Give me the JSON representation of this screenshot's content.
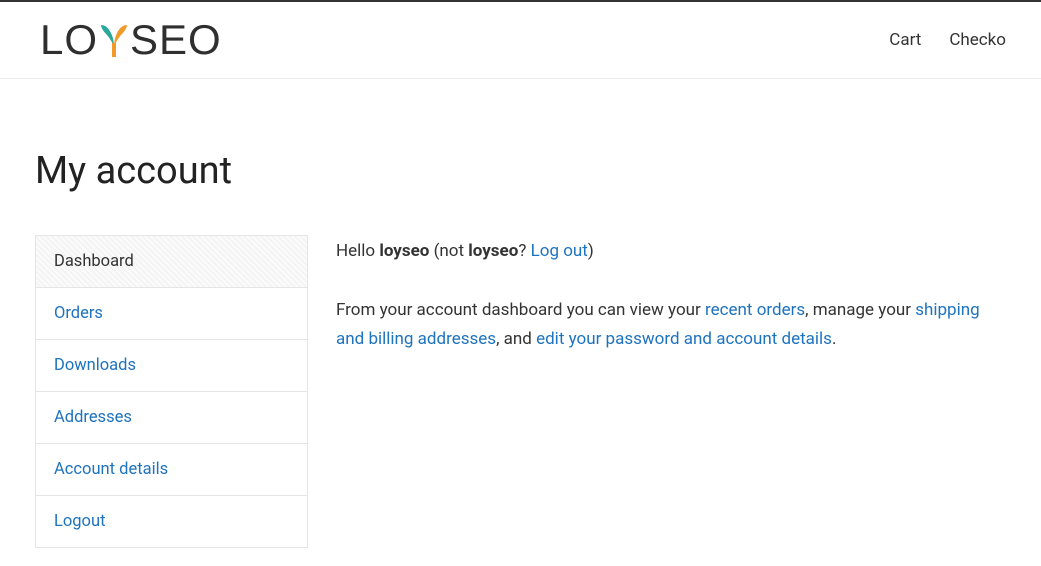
{
  "header": {
    "logo_left": "LO",
    "logo_right": "SEO",
    "nav": {
      "cart": "Cart",
      "checkout": "Checko"
    }
  },
  "page": {
    "title": "My account"
  },
  "sidebar": {
    "items": [
      {
        "label": "Dashboard",
        "active": true
      },
      {
        "label": "Orders",
        "active": false
      },
      {
        "label": "Downloads",
        "active": false
      },
      {
        "label": "Addresses",
        "active": false
      },
      {
        "label": "Account details",
        "active": false
      },
      {
        "label": "Logout",
        "active": false
      }
    ]
  },
  "greeting": {
    "hello": "Hello ",
    "username": "loyseo",
    "not_prefix": " (not ",
    "username2": "loyseo",
    "not_suffix": "? ",
    "logout": "Log out",
    "close": ")"
  },
  "body": {
    "p1": "From your account dashboard you can view your ",
    "recent_orders": "recent orders",
    "p2": ", manage your ",
    "addresses": "shipping and billing addresses",
    "p3": ", and ",
    "edit_details": "edit your password and account details",
    "p4": "."
  }
}
